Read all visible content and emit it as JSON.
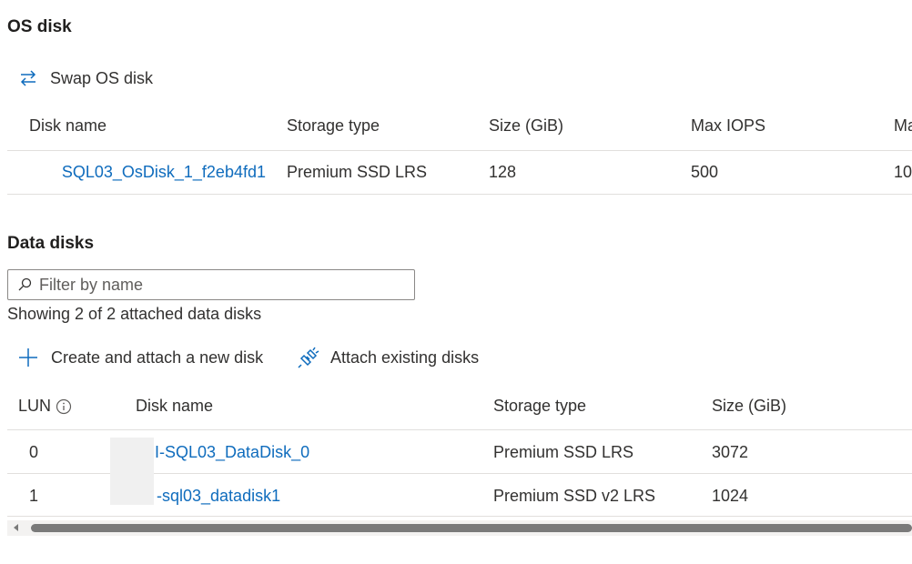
{
  "os_disk": {
    "heading": "OS disk",
    "swap_label": "Swap OS disk",
    "columns": [
      "Disk name",
      "Storage type",
      "Size (GiB)",
      "Max IOPS",
      "Ma"
    ],
    "row": {
      "disk_name": "SQL03_OsDisk_1_f2eb4fd1",
      "storage_type": "Premium SSD LRS",
      "size": "128",
      "max_iops": "500",
      "extra": "10"
    }
  },
  "data_disks": {
    "heading": "Data disks",
    "filter_placeholder": "Filter by name",
    "showing_text": "Showing 2 of 2 attached data disks",
    "create_label": "Create and attach a new disk",
    "attach_label": "Attach existing disks",
    "columns": [
      "LUN",
      "Disk name",
      "Storage type",
      "Size (GiB)"
    ],
    "rows": [
      {
        "lun": "0",
        "disk_name": "I-SQL03_DataDisk_0",
        "storage_type": "Premium SSD LRS",
        "size": "3072"
      },
      {
        "lun": "1",
        "disk_name": "-sql03_datadisk1",
        "storage_type": "Premium SSD v2 LRS",
        "size": "1024"
      }
    ]
  },
  "colors": {
    "link": "#0f6cbd",
    "text": "#323130",
    "divider": "#e1dfdd"
  }
}
